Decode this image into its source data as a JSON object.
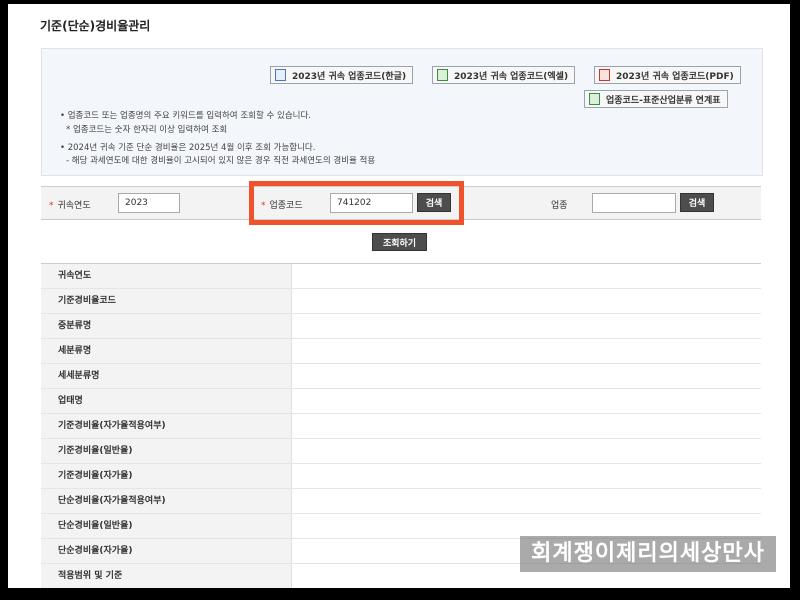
{
  "page_title": "기준(단순)경비율관리",
  "downloads": {
    "hangul": "2023년 귀속 업종코드(한글)",
    "excel": "2023년 귀속 업종코드(엑셀)",
    "pdf": "2023년 귀속 업종코드(PDF)",
    "link_table": "업종코드-표준산업분류 연계표"
  },
  "notes": {
    "n1": "• 업종코드 또는 업종명의 주요 키워드를 입력하여 조회할 수 있습니다.",
    "n1_sub": "* 업종코드는 숫자 한자리 이상 입력하여 조회",
    "n2": "• 2024년 귀속 기준 단순 경비율은 2025년 4월 이후 조회 가능합니다.",
    "n2_sub": "- 해당 과세연도에 대한 경비율이 고시되어 있지 않은 경우 직전 과세연도의 경비율 적용"
  },
  "search": {
    "required_mark": "*",
    "year_label": "귀속연도",
    "year_value": "2023",
    "code_label": "업종코드",
    "code_value": "741202",
    "code_search_button": "검색",
    "industry_label": "업종",
    "industry_value": "",
    "industry_search_button": "검색",
    "query_button": "조회하기"
  },
  "result_fields": [
    "귀속연도",
    "기준경비율코드",
    "중분류명",
    "세분류명",
    "세세분류명",
    "업태명",
    "기준경비율(자가율적용여부)",
    "기준경비율(일반율)",
    "기준경비율(자가율)",
    "단순경비율(자가율적용여부)",
    "단순경비율(일반율)",
    "단순경비율(자가율)",
    "적용범위 및 기준"
  ],
  "watermark": "회계쟁이제리의세상만사",
  "colors": {
    "highlight": "#f0532b",
    "dark_button": "#4d4d4d",
    "info_bg": "#f3f6fb"
  }
}
